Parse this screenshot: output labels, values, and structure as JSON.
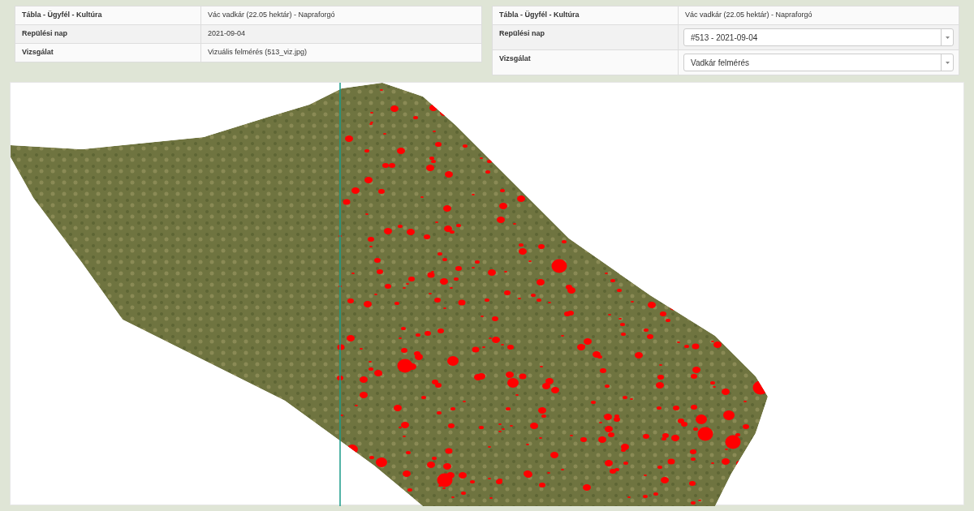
{
  "left_table": {
    "rows": [
      {
        "label": "Tábla - Ügyfél - Kultúra",
        "kind": "text",
        "value": "Vác vadkár (22.05 hektár) - Napraforgó"
      },
      {
        "label": "Repülési nap",
        "kind": "text",
        "value": "2021-09-04"
      },
      {
        "label": "Vizsgálat",
        "kind": "text",
        "value": "Vizuális felmérés (513_viz.jpg)"
      }
    ]
  },
  "right_table": {
    "rows": [
      {
        "label": "Tábla - Ügyfél - Kultúra",
        "kind": "text",
        "value": "Vác vadkár (22.05 hektár) - Napraforgó"
      },
      {
        "label": "Repülési nap",
        "kind": "select",
        "value": "#513 - 2021-09-04"
      },
      {
        "label": "Vizsgálat",
        "kind": "select",
        "value": "Vadkár felmérés"
      }
    ]
  }
}
